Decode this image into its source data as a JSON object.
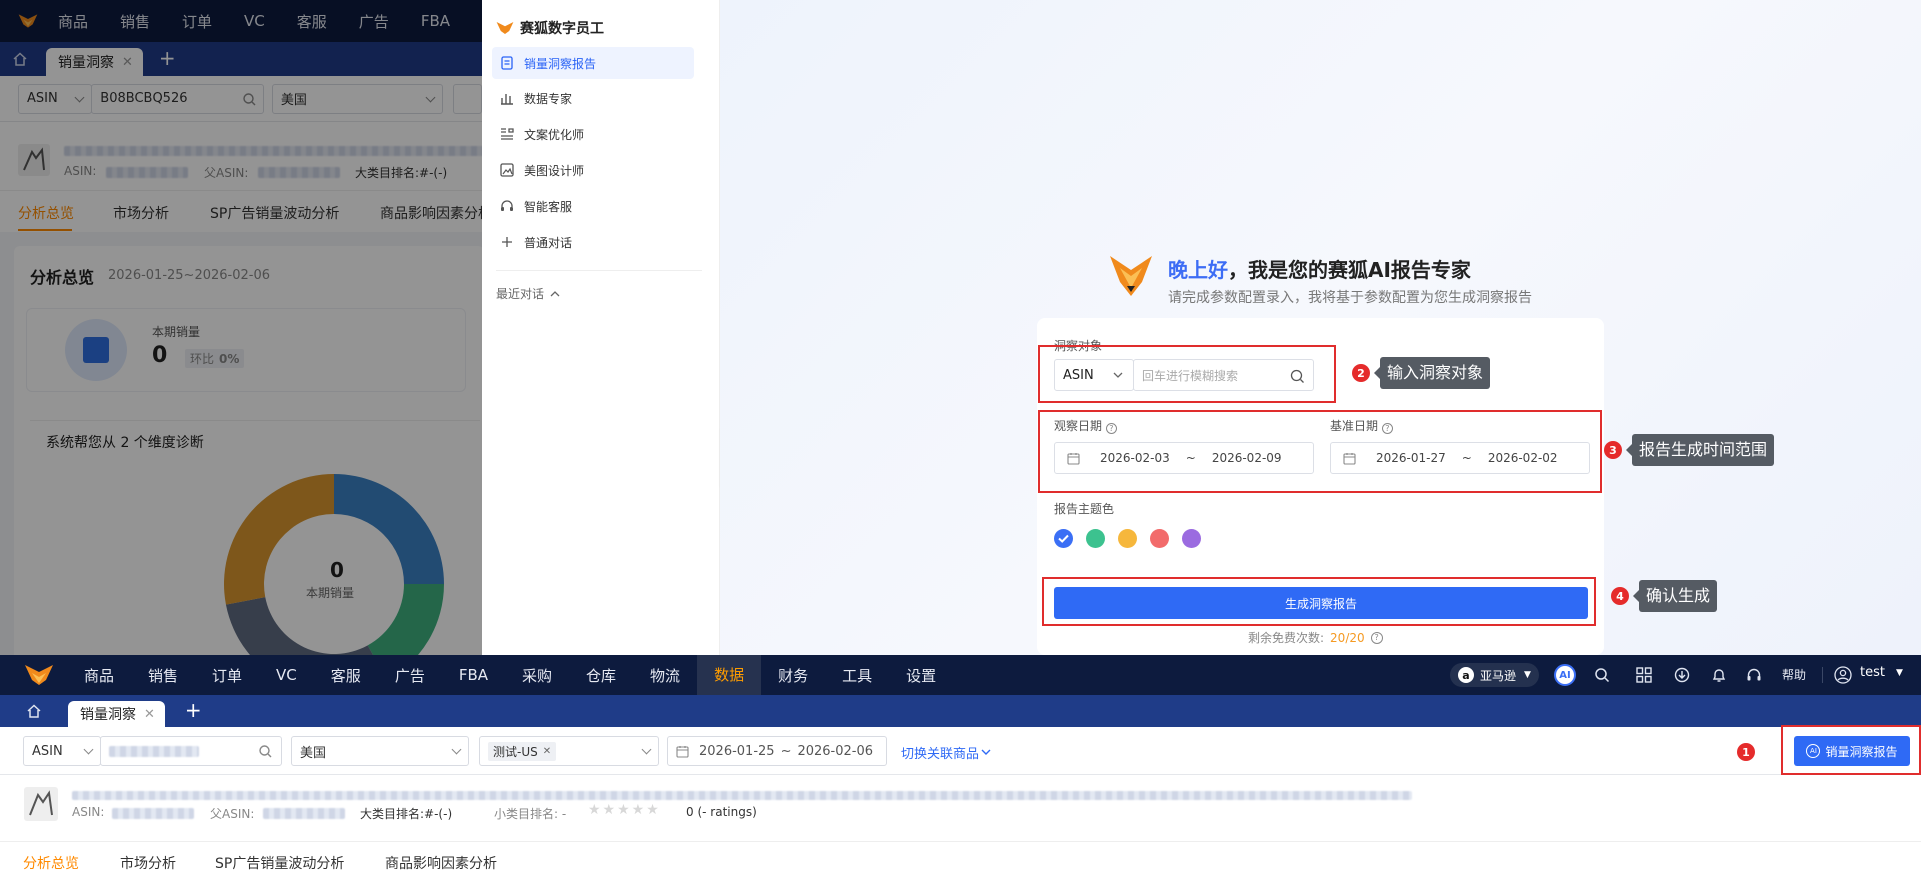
{
  "nav": {
    "items": [
      "商品",
      "销售",
      "订单",
      "VC",
      "客服",
      "广告",
      "FBA",
      "采购",
      "仓库",
      "物流",
      "数据",
      "财务",
      "工具",
      "设置"
    ],
    "active": "数据",
    "store": "亚马逊",
    "ai_badge": "AI",
    "help": "帮助",
    "user": "test"
  },
  "tabs": {
    "current": "销量洞察",
    "close": "✕",
    "add": "+"
  },
  "filter_bg": {
    "type": "ASIN",
    "asin": "B08BCBQ526",
    "country": "美国"
  },
  "filter": {
    "type": "ASIN",
    "country": "美国",
    "shop_tag": "测试-US",
    "date_start": "2026-01-25",
    "date_sep": "~",
    "date_end": "2026-02-06",
    "switch_link": "切换关联商品",
    "report_button": "销量洞察报告"
  },
  "product": {
    "asin_label": "ASIN:",
    "parent_label": "父ASIN:",
    "rank_label": "大类目排名:",
    "rank_value": "#-(-)",
    "sub_rank_label": "小类目排名:",
    "sub_rank_value": "-",
    "ratings": "0 (- ratings)",
    "rating_stars": 0
  },
  "subtabs": [
    "分析总览",
    "市场分析",
    "SP广告销量波动分析",
    "商品影响因素分析"
  ],
  "overview": {
    "title": "分析总览",
    "range": "2026-01-25~2026-02-06",
    "sales_label": "本期销量",
    "sales_value": "0",
    "ring_label": "环比",
    "ring_value": "0%",
    "diag_title": "系统帮您从 2 个维度诊断",
    "donut_value": "0",
    "donut_label": "本期销量"
  },
  "donut_segments": [
    {
      "value": 25,
      "color": "#3b82c4"
    },
    {
      "value": 17,
      "color": "#3fb07f"
    },
    {
      "value": 30,
      "color": "#5f6b82"
    },
    {
      "value": 28,
      "color": "#d9962f"
    }
  ],
  "panel": {
    "title": "赛狐数字员工",
    "items": [
      "销量洞察报告",
      "数据专家",
      "文案优化师",
      "美图设计师",
      "智能客服",
      "普通对话"
    ],
    "recent": "最近对话"
  },
  "assistant": {
    "greeting": "晚上好",
    "intro": "，我是您的赛狐AI报告专家",
    "subtitle": "请完成参数配置录入，我将基于参数配置为您生成洞察报告",
    "target_label": "洞察对象",
    "target_type": "ASIN",
    "target_placeholder": "回车进行模糊搜索",
    "obs_label": "观察日期",
    "obs_start": "2026-02-03",
    "obs_end": "2026-02-09",
    "base_label": "基准日期",
    "base_start": "2026-01-27",
    "base_end": "2026-02-02",
    "date_sep": "~",
    "theme_label": "报告主题色",
    "theme_colors": [
      "#3b6ff5",
      "#3cc28f",
      "#f6b73c",
      "#f26b6b",
      "#9b6be0"
    ],
    "generate": "生成洞察报告",
    "free_label": "剩余免费次数:",
    "free_value": "20/20"
  },
  "annotations": [
    {
      "num": "1",
      "text": ""
    },
    {
      "num": "2",
      "text": "输入洞察对象"
    },
    {
      "num": "3",
      "text": "报告生成时间范围"
    },
    {
      "num": "4",
      "text": "确认生成"
    }
  ]
}
